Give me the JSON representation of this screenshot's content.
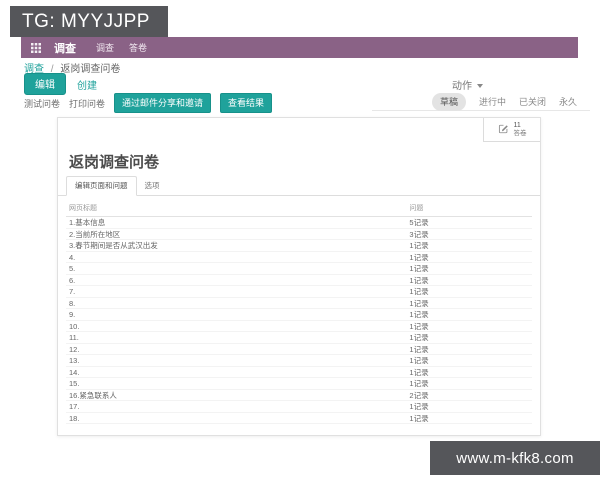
{
  "top_banner": {
    "text": "TG: MYYJJPP"
  },
  "bottom_banner": {
    "text": "www.m-kfk8.com"
  },
  "navbar": {
    "app_title": "调查",
    "menus": [
      {
        "label": "调查"
      },
      {
        "label": "答卷"
      }
    ]
  },
  "breadcrumb": {
    "items": [
      "调查",
      "返岗调查问卷"
    ],
    "separator": "/"
  },
  "actions": {
    "edit": "编辑",
    "create": "创建",
    "action_menu": "动作"
  },
  "toolbar": {
    "buttons": [
      {
        "label": "测试问卷",
        "style": "link"
      },
      {
        "label": "打印问卷",
        "style": "link"
      },
      {
        "label": "通过邮件分享和邀请",
        "style": "primary"
      },
      {
        "label": "查看结果",
        "style": "primary"
      }
    ]
  },
  "statusbar": {
    "states": [
      {
        "label": "草稿",
        "active": true
      },
      {
        "label": "进行中",
        "active": false
      },
      {
        "label": "已关闭",
        "active": false
      },
      {
        "label": "永久",
        "active": false
      }
    ]
  },
  "sheet": {
    "smart_button": {
      "count": "11",
      "label": "答卷",
      "icon": "edit-note-icon"
    },
    "title": "返岗调查问卷",
    "tabs": [
      {
        "label": "编辑页面和问题",
        "active": true
      },
      {
        "label": "选项",
        "active": false
      }
    ],
    "table": {
      "columns": [
        "网页标题",
        "问题"
      ],
      "rows": [
        {
          "title": "1.基本信息",
          "count": "5记录"
        },
        {
          "title": "2.当前所在地区",
          "count": "3记录"
        },
        {
          "title": "3.春节期间是否从武汉出发",
          "count": "1记录"
        },
        {
          "title": "4.",
          "count": "1记录"
        },
        {
          "title": "5.",
          "count": "1记录"
        },
        {
          "title": "6.",
          "count": "1记录"
        },
        {
          "title": "7.",
          "count": "1记录"
        },
        {
          "title": "8.",
          "count": "1记录"
        },
        {
          "title": "9.",
          "count": "1记录"
        },
        {
          "title": "10.",
          "count": "1记录"
        },
        {
          "title": "11.",
          "count": "1记录"
        },
        {
          "title": "12.",
          "count": "1记录"
        },
        {
          "title": "13.",
          "count": "1记录"
        },
        {
          "title": "14.",
          "count": "1记录"
        },
        {
          "title": "15.",
          "count": "1记录"
        },
        {
          "title": "16.紧急联系人",
          "count": "2记录"
        },
        {
          "title": "17.",
          "count": "1记录"
        },
        {
          "title": "18.",
          "count": "1记录"
        }
      ]
    }
  },
  "colors": {
    "accent": "#1fa29b",
    "navbar": "#8a6286",
    "banner": "#55565a"
  }
}
